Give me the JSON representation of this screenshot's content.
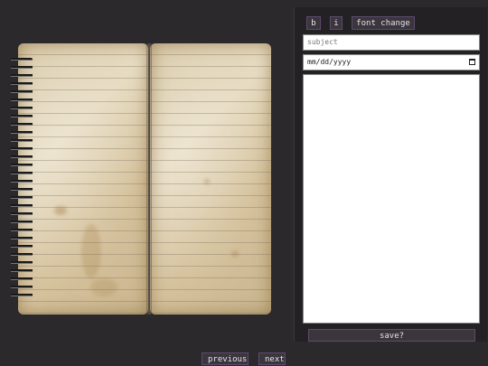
{
  "toolbar": {
    "bold_label": "b",
    "italic_label": "i",
    "font_label": "font change"
  },
  "form": {
    "subject_placeholder": "subject",
    "date_placeholder": "mm/dd/yyyy",
    "body_value": ""
  },
  "actions": {
    "save_label": "save?",
    "previous_label": "previous",
    "next_label": "next"
  },
  "colors": {
    "background": "#2b292b",
    "panel": "#232123",
    "button_bg": "#3a363c",
    "button_border": "#5e4a70",
    "paper": "#e7dcc2"
  }
}
